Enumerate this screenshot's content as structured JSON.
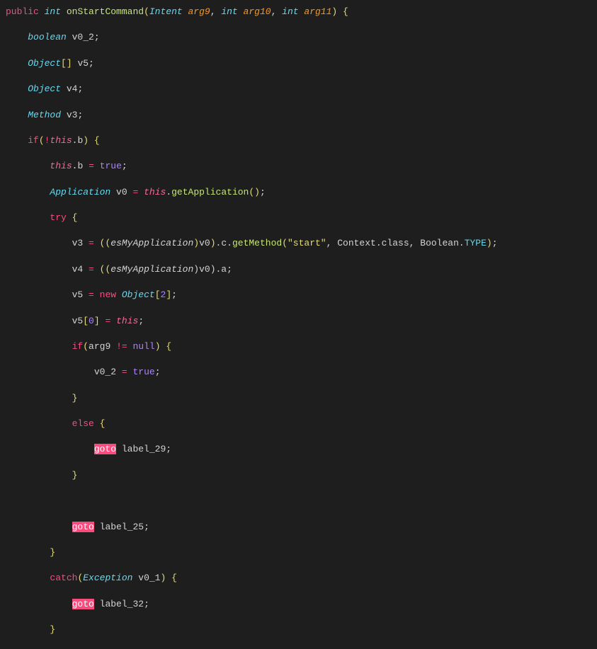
{
  "code": {
    "l1": {
      "kw1": "public",
      "t1": "int",
      "m": "onStartCommand",
      "p": "(",
      "t2": "Intent",
      "a1": "arg9",
      "c1": ", ",
      "t3": "int",
      "a2": "arg10",
      "c2": ", ",
      "t4": "int",
      "a3": "arg11",
      "cp": ")",
      "b": " {"
    },
    "l2": {
      "t": "boolean",
      "v": " v0_2",
      "s": ";"
    },
    "l3": {
      "t": "Object",
      "br": "[]",
      "v": " v5",
      "s": ";"
    },
    "l4": {
      "t": "Object",
      "v": " v4",
      "s": ";"
    },
    "l5": {
      "t": "Method",
      "v": " v3",
      "s": ";"
    },
    "l6": {
      "kw": "if",
      "p": "(",
      "op": "!",
      "th": "this",
      "d": ".",
      "m": "b",
      "cp": ")",
      "b": " {"
    },
    "l7": {
      "th": "this",
      "d": ".",
      "m": "b ",
      "op": "=",
      "sp": " ",
      "bool": "true",
      "s": ";"
    },
    "l8": {
      "t": "Application",
      "v": " v0 ",
      "op": "=",
      "sp": " ",
      "th": "this",
      "d": ".",
      "m": "getApplication",
      "p": "()",
      "s": ";"
    },
    "l9": {
      "kw": "try",
      "b": " {"
    },
    "l10": {
      "v1": "v3 ",
      "op1": "=",
      "sp1": " ",
      "p1": "((",
      "cast": "esMyApplication",
      "p2": ")",
      "v2": "v0",
      "p3": ")",
      "d1": ".",
      "m1": "c",
      "d2": ".",
      "m2": "getMethod",
      "p4": "(",
      "str": "\"start\"",
      "c1": ", ",
      "id1": "Context",
      "d3": ".",
      "m3": "class",
      "c2": ", ",
      "id2": "Boolean",
      "d4": ".",
      "const": "TYPE",
      "p5": ")",
      "s": ";"
    },
    "l11": {
      "v1": "v4 ",
      "op": "=",
      "sp": " ",
      "p1": "((",
      "cast": "esMyApplication",
      "v2": ")v0).a",
      "s": ";"
    },
    "l12": {
      "v1": "v5 ",
      "op": "=",
      "sp": " ",
      "kw": "new",
      "sp2": " ",
      "t": "Object",
      "br": "[",
      "n": "2",
      "cb": "]",
      "s": ";"
    },
    "l13": {
      "v": "v5",
      "br": "[",
      "n": "0",
      "cb": "]",
      "sp": " ",
      "op": "=",
      "sp2": " ",
      "th": "this",
      "s": ";"
    },
    "l14": {
      "kw": "if",
      "p": "(",
      "a": "arg9 ",
      "op": "!=",
      "sp": " ",
      "bool": "null",
      "cp": ")",
      "b": " {"
    },
    "l15": {
      "v": "v0_2 ",
      "op": "=",
      "sp": " ",
      "bool": "true",
      "s": ";"
    },
    "l16": {
      "b": "}"
    },
    "l17": {
      "kw": "else",
      "b": " {"
    },
    "l18": {
      "kw": "goto",
      "lbl": " label_29",
      "s": ";"
    },
    "l19": {
      "b": "}"
    },
    "l20": "",
    "l21": {
      "kw": "goto",
      "lbl": " label_25",
      "s": ";"
    },
    "l22": {
      "b": "}"
    },
    "l23": {
      "kw": "catch",
      "p": "(",
      "t": "Exception",
      "v": " v0_1",
      "cp": ")",
      "b": " {"
    },
    "l24": {
      "kw": "goto",
      "lbl": " label_32",
      "s": ";"
    },
    "l25": {
      "b": "}"
    }
  }
}
